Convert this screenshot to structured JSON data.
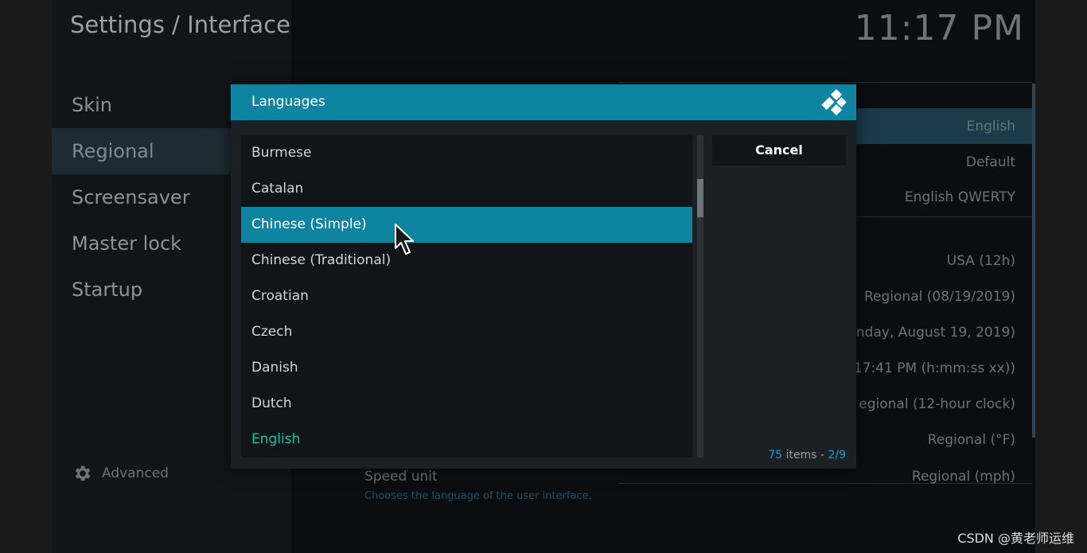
{
  "window": {
    "title": "Settings / Interface",
    "clock": "11:17 PM"
  },
  "sidebar": {
    "items": [
      {
        "label": "Skin"
      },
      {
        "label": "Regional"
      },
      {
        "label": "Screensaver"
      },
      {
        "label": "Master lock"
      },
      {
        "label": "Startup"
      }
    ],
    "advanced_label": "Advanced",
    "advanced_icon": "gear-icon"
  },
  "settings": {
    "values": [
      "English",
      "Default",
      "English QWERTY",
      "USA (12h)",
      "Regional (08/19/2019)",
      "nday, August 19, 2019)",
      "17:41 PM (h:mm:ss xx))",
      "egional (12-hour clock)",
      "Regional (°F)"
    ],
    "speed_label": "Speed unit",
    "speed_value": "Regional (mph)",
    "hint": "Chooses the language of the user interface."
  },
  "dialog": {
    "title": "Languages",
    "logo_icon": "kodi-logo-icon",
    "items": [
      {
        "label": "Burmese"
      },
      {
        "label": "Catalan"
      },
      {
        "label": "Chinese (Simple)",
        "state": "selected"
      },
      {
        "label": "Chinese (Traditional)"
      },
      {
        "label": "Croatian"
      },
      {
        "label": "Czech"
      },
      {
        "label": "Danish"
      },
      {
        "label": "Dutch"
      },
      {
        "label": "English",
        "state": "current"
      }
    ],
    "cancel_label": "Cancel",
    "count_number": "75",
    "count_text": " items - ",
    "page": "2/9",
    "selected_color": "#0f84a1",
    "current_color": "#18c3a5"
  },
  "watermark": "CSDN @黄老师运维"
}
